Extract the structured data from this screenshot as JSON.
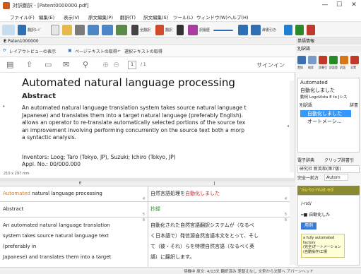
{
  "window": {
    "title": "対訳翻訳 - [Patent0000000.pdf]"
  },
  "menu": [
    "ファイル(F)",
    "編集(E)",
    "表示(V)",
    "原文編集(P)",
    "翻訳(T)",
    "訳文編集(S)",
    "ツール(L)",
    "ウィンドウ(W)",
    "ヘルプ(H)"
  ],
  "toolbar": {
    "trans_label": "翻訳ﾓｰﾄﾞ",
    "all_trans": "全翻訳",
    "trans": "翻訳",
    "history": "訳履歴",
    "bilingual": "辞書引き",
    "single": "単語",
    "conv": "変換"
  },
  "doc": {
    "tab_letter": "E",
    "tab_name": "Paten1000000",
    "layout_btn": "レイアウトビューの表示",
    "get_page_text": "ページテキストの取得",
    "get_sel_text": "選択テキストの取得",
    "page_no": "1",
    "page_total": "/ 1",
    "signin": "サインイン",
    "pdf_title": "Automated natural language processing",
    "abstract_head": "Abstract",
    "abstract_lines": [
      "An automated natural language translation system takes source natural language t",
      "Japanese) and translates them into a target natural language (preferably English).",
      "allows an operator to re-translate automatically selected portions of the source tex",
      "an improvement involving performing concurrently on the source text both a morp",
      "a syntactic analysis."
    ],
    "inventors": "Inventors:   Loog; Taro (Tokyo, JP), Suzuki; Ichiro (Tokyo, JP)",
    "appl": "Appl. No.:   00/000.000",
    "page_size": "210 x 297 mm"
  },
  "editor": {
    "col_e": "E",
    "col_j": "J",
    "rows": [
      {
        "num": "4",
        "src": "Automated natural language processing"
      },
      {
        "num": "5",
        "src": "Abstract"
      },
      {
        "num": "6",
        "src_lines": [
          "An automated natural language translation",
          "system takes source natural language text",
          "(preferably in",
          "Japanese) and translates them into a target"
        ]
      }
    ],
    "tgt": [
      {
        "num": "4",
        "a": "自然言語処理を",
        "b": "自動化しました"
      },
      {
        "num": "5",
        "text": "抄録"
      },
      {
        "num": "6",
        "lines": [
          "自動化された自然言語翻訳システムが（なるべ",
          "く日本語で）発信源自然言語本文をとって、そし",
          "て（彼・それ）らを特標自然言語（なるべく英",
          "語）に翻訳します。"
        ]
      }
    ]
  },
  "right": {
    "panel_title": "単語情報",
    "sub_title": "別訳語",
    "icons": [
      "置換",
      "検索",
      "辞書引",
      "訳語登",
      "訳語",
      "全置"
    ],
    "word": "Automated",
    "translation": "自動化しました",
    "engine": "動詞  LogoVista E to Jシス",
    "alt_head": "別訳語",
    "alt_head2": "辞書",
    "alt1": "自動化しました",
    "alt2": "オートメーシ...",
    "edict_title": "電子辞典",
    "clip_check": "クリップ辞書引",
    "dict_name": "研究社 新英和(第7版)",
    "match_label": "完全一前方",
    "match_mode": "Autom",
    "kata": "'au·to·mat·ed",
    "pron": "/-rɪd/",
    "pos": "━■ 自動化した",
    "yorei": "用例",
    "note_lines": [
      "a fully automated",
      "factory",
      "(完全)オートメーション",
      "(自動操作)工場"
    ]
  },
  "status": "待機中  原文: 4/13文  翻訳済み  差替えなし  文型から文節へ  アパーンヘッド"
}
